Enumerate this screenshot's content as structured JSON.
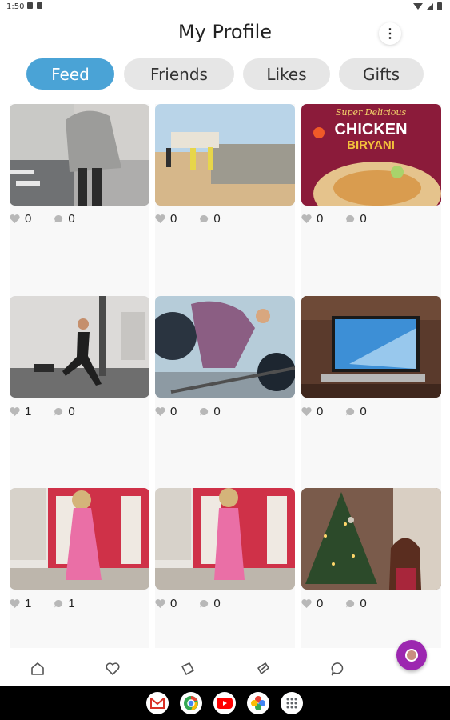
{
  "status": {
    "time": "1:50"
  },
  "header": {
    "title": "My Profile",
    "menu_glyph": "⋮"
  },
  "tabs": [
    {
      "label": "Feed",
      "active": true
    },
    {
      "label": "Friends",
      "active": false
    },
    {
      "label": "Likes",
      "active": false
    },
    {
      "label": "Gifts",
      "active": false
    }
  ],
  "posts": [
    {
      "image": "street-knit-sweater-photo",
      "likes": "0",
      "comments": "0"
    },
    {
      "image": "construction-workers-site-photo",
      "likes": "0",
      "comments": "0"
    },
    {
      "image": "chicken-biryani-promo",
      "likes": "0",
      "comments": "0",
      "promo_top": "Super Delicious",
      "promo_main": "CHICKEN",
      "promo_sub": "BIRYANI"
    },
    {
      "image": "gym-lunge-photo",
      "likes": "1",
      "comments": "0"
    },
    {
      "image": "deadlift-barbell-photo",
      "likes": "0",
      "comments": "0"
    },
    {
      "image": "laptop-desk-photo",
      "likes": "0",
      "comments": "0"
    },
    {
      "image": "pink-dress-red-door-photo",
      "likes": "1",
      "comments": "1"
    },
    {
      "image": "pink-dress-red-door-photo-2",
      "likes": "0",
      "comments": "0"
    },
    {
      "image": "christmas-tree-portrait-photo",
      "likes": "0",
      "comments": "0"
    }
  ],
  "bottom_nav": [
    "home-icon",
    "heart-icon",
    "ticket-icon",
    "gift-icon",
    "chat-icon"
  ],
  "dock": [
    "gmail",
    "chrome",
    "youtube",
    "photos",
    "apps"
  ],
  "colors": {
    "accent": "#4aa3d6",
    "fab": "#9c27b0"
  }
}
